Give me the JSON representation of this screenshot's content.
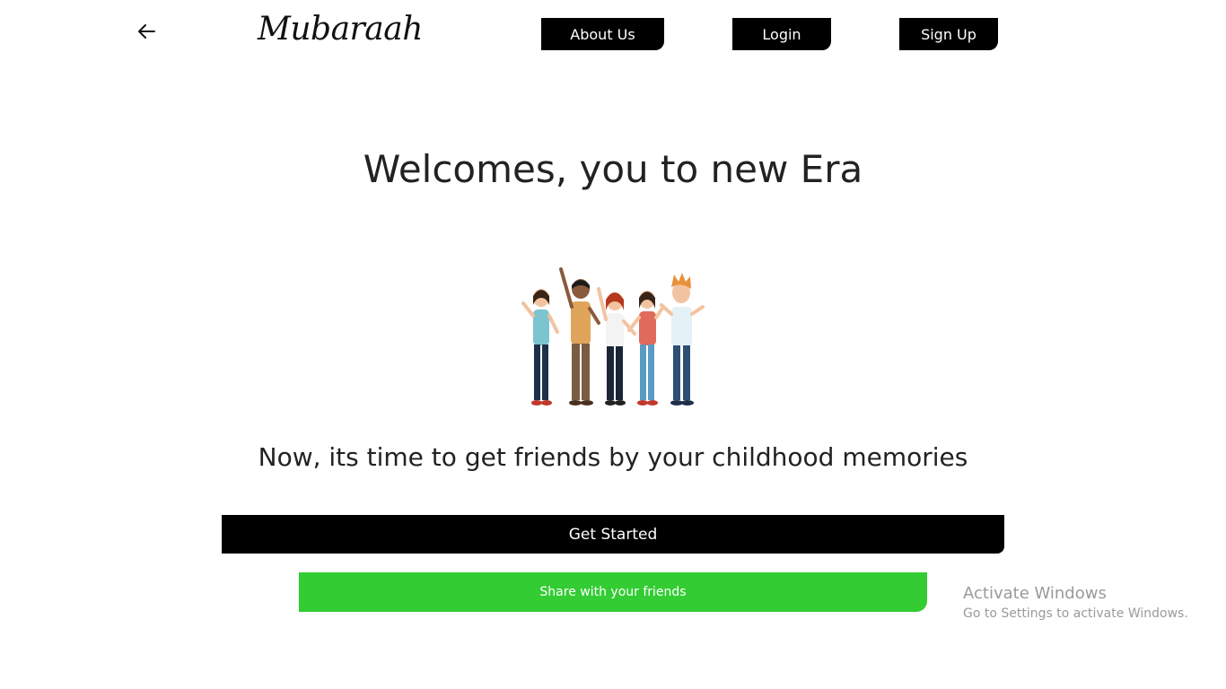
{
  "header": {
    "brand": "Mubaraah",
    "nav": {
      "about": "About Us",
      "login": "Login",
      "signup": "Sign Up"
    }
  },
  "hero": {
    "headline": "Welcomes, you to new Era",
    "tagline": "Now, its time to get friends by your childhood memories"
  },
  "actions": {
    "get_started": "Get Started",
    "share": "Share with your friends"
  },
  "watermark": {
    "title": "Activate Windows",
    "subtitle": "Go to Settings to activate Windows."
  },
  "colors": {
    "primary_button": "#000000",
    "share_button": "#33cc33",
    "text": "#222222"
  }
}
